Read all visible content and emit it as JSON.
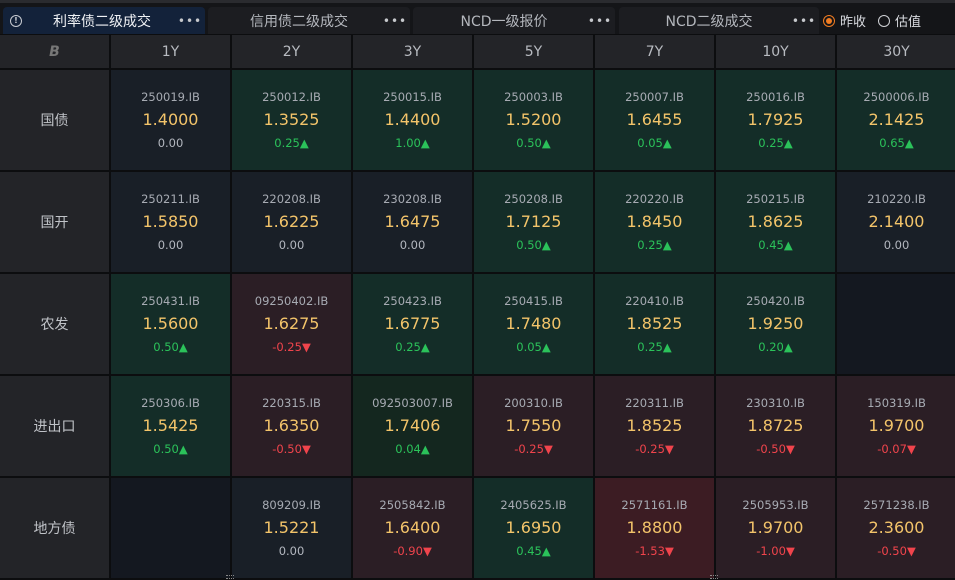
{
  "tabs": [
    {
      "label": "利率债二级成交",
      "active": true,
      "more": "•••"
    },
    {
      "label": "信用债二级成交",
      "active": false,
      "more": "•••"
    },
    {
      "label": "NCD一级报价",
      "active": false,
      "more": "•••"
    },
    {
      "label": "NCD二级成交",
      "active": false,
      "more": "•••"
    }
  ],
  "radios": [
    {
      "label": "昨收",
      "checked": true
    },
    {
      "label": "估值",
      "checked": false
    }
  ],
  "corner_logo": "B",
  "columns": [
    "1Y",
    "2Y",
    "3Y",
    "5Y",
    "7Y",
    "10Y",
    "30Y"
  ],
  "rows": [
    {
      "label": "国债",
      "cells": [
        {
          "tone": "neutral",
          "code": "250019.IB",
          "yield": "1.4000",
          "chg": "0.00",
          "dir": "flat"
        },
        {
          "tone": "green",
          "code": "250012.IB",
          "yield": "1.3525",
          "chg": "0.25▲",
          "dir": "up"
        },
        {
          "tone": "green",
          "code": "250015.IB",
          "yield": "1.4400",
          "chg": "1.00▲",
          "dir": "up"
        },
        {
          "tone": "green",
          "code": "250003.IB",
          "yield": "1.5200",
          "chg": "0.50▲",
          "dir": "up"
        },
        {
          "tone": "green",
          "code": "250007.IB",
          "yield": "1.6455",
          "chg": "0.05▲",
          "dir": "up"
        },
        {
          "tone": "green",
          "code": "250016.IB",
          "yield": "1.7925",
          "chg": "0.25▲",
          "dir": "up"
        },
        {
          "tone": "green",
          "code": "2500006.IB",
          "yield": "2.1425",
          "chg": "0.65▲",
          "dir": "up"
        }
      ]
    },
    {
      "label": "国开",
      "cells": [
        {
          "tone": "neutral",
          "code": "250211.IB",
          "yield": "1.5850",
          "chg": "0.00",
          "dir": "flat"
        },
        {
          "tone": "neutral",
          "code": "220208.IB",
          "yield": "1.6225",
          "chg": "0.00",
          "dir": "flat"
        },
        {
          "tone": "neutral",
          "code": "230208.IB",
          "yield": "1.6475",
          "chg": "0.00",
          "dir": "flat"
        },
        {
          "tone": "green",
          "code": "250208.IB",
          "yield": "1.7125",
          "chg": "0.50▲",
          "dir": "up"
        },
        {
          "tone": "green",
          "code": "220220.IB",
          "yield": "1.8450",
          "chg": "0.25▲",
          "dir": "up"
        },
        {
          "tone": "green",
          "code": "250215.IB",
          "yield": "1.8625",
          "chg": "0.45▲",
          "dir": "up"
        },
        {
          "tone": "neutral",
          "code": "210220.IB",
          "yield": "2.1400",
          "chg": "0.00",
          "dir": "flat"
        }
      ]
    },
    {
      "label": "农发",
      "cells": [
        {
          "tone": "green",
          "code": "250431.IB",
          "yield": "1.5600",
          "chg": "0.50▲",
          "dir": "up"
        },
        {
          "tone": "red",
          "code": "09250402.IB",
          "yield": "1.6275",
          "chg": "-0.25▼",
          "dir": "dn"
        },
        {
          "tone": "green",
          "code": "250423.IB",
          "yield": "1.6775",
          "chg": "0.25▲",
          "dir": "up"
        },
        {
          "tone": "green",
          "code": "250415.IB",
          "yield": "1.7480",
          "chg": "0.05▲",
          "dir": "up"
        },
        {
          "tone": "green",
          "code": "220410.IB",
          "yield": "1.8525",
          "chg": "0.25▲",
          "dir": "up"
        },
        {
          "tone": "green",
          "code": "250420.IB",
          "yield": "1.9250",
          "chg": "0.20▲",
          "dir": "up"
        },
        {
          "tone": "empty"
        }
      ]
    },
    {
      "label": "进出口",
      "cells": [
        {
          "tone": "green",
          "code": "250306.IB",
          "yield": "1.5425",
          "chg": "0.50▲",
          "dir": "up"
        },
        {
          "tone": "red",
          "code": "220315.IB",
          "yield": "1.6350",
          "chg": "-0.50▼",
          "dir": "dn"
        },
        {
          "tone": "green2",
          "code": "092503007.IB",
          "yield": "1.7406",
          "chg": "0.04▲",
          "dir": "up"
        },
        {
          "tone": "red",
          "code": "200310.IB",
          "yield": "1.7550",
          "chg": "-0.25▼",
          "dir": "dn"
        },
        {
          "tone": "red",
          "code": "220311.IB",
          "yield": "1.8525",
          "chg": "-0.25▼",
          "dir": "dn"
        },
        {
          "tone": "red",
          "code": "230310.IB",
          "yield": "1.8725",
          "chg": "-0.50▼",
          "dir": "dn"
        },
        {
          "tone": "red",
          "code": "150319.IB",
          "yield": "1.9700",
          "chg": "-0.07▼",
          "dir": "dn"
        }
      ]
    },
    {
      "label": "地方债",
      "cells": [
        {
          "tone": "empty"
        },
        {
          "tone": "neutral",
          "code": "809209.IB",
          "yield": "1.5221",
          "chg": "0.00",
          "dir": "flat"
        },
        {
          "tone": "red",
          "code": "2505842.IB",
          "yield": "1.6400",
          "chg": "-0.90▼",
          "dir": "dn"
        },
        {
          "tone": "green",
          "code": "2405625.IB",
          "yield": "1.6950",
          "chg": "0.45▲",
          "dir": "up"
        },
        {
          "tone": "red2",
          "code": "2571161.IB",
          "yield": "1.8800",
          "chg": "-1.53▼",
          "dir": "dn"
        },
        {
          "tone": "red",
          "code": "2505953.IB",
          "yield": "1.9700",
          "chg": "-1.00▼",
          "dir": "dn"
        },
        {
          "tone": "red",
          "code": "2571238.IB",
          "yield": "2.3600",
          "chg": "-0.50▼",
          "dir": "dn"
        }
      ]
    }
  ]
}
